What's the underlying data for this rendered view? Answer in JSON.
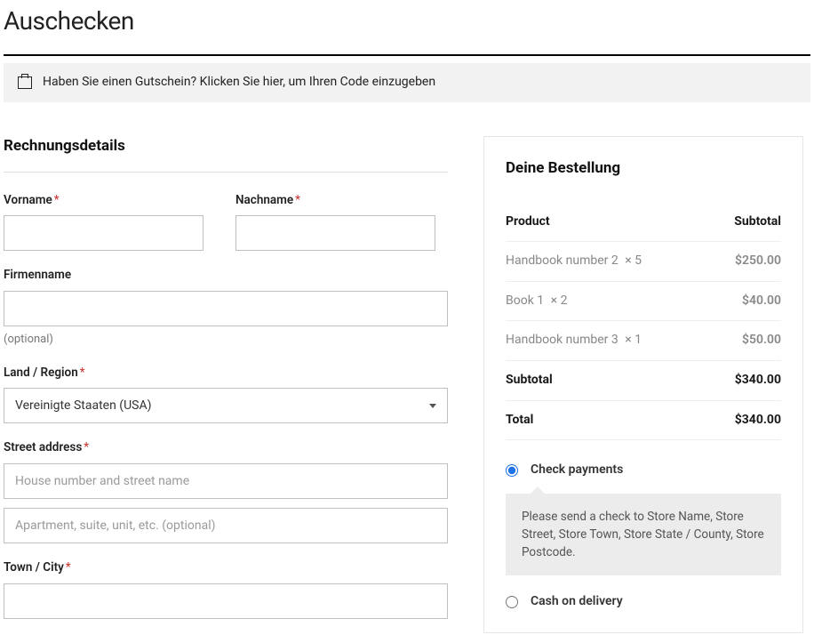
{
  "pageTitle": "Auschecken",
  "coupon": {
    "prompt": "Haben Sie einen Gutschein?",
    "link": "Klicken Sie hier, um Ihren Code einzugeben"
  },
  "billing": {
    "heading": "Rechnungsdetails",
    "firstNameLabel": "Vorname",
    "lastNameLabel": "Nachname",
    "companyLabel": "Firmenname",
    "companyOptional": "(optional)",
    "countryLabel": "Land / Region",
    "countryValue": "Vereinigte Staaten (USA)",
    "streetLabel": "Street address",
    "streetPlaceholder1": "House number and street name",
    "streetPlaceholder2": "Apartment, suite, unit, etc. (optional)",
    "townLabel": "Town / City"
  },
  "order": {
    "heading": "Deine Bestellung",
    "productHeader": "Product",
    "subtotalHeader": "Subtotal",
    "items": [
      {
        "name": "Handbook number 2",
        "qty": "× 5",
        "price": "$250.00"
      },
      {
        "name": "Book 1",
        "qty": "× 2",
        "price": "$40.00"
      },
      {
        "name": "Handbook number 3",
        "qty": "× 1",
        "price": "$50.00"
      }
    ],
    "subtotalLabel": "Subtotal",
    "subtotalValue": "$340.00",
    "totalLabel": "Total",
    "totalValue": "$340.00",
    "payments": {
      "checkLabel": "Check payments",
      "checkDesc": "Please send a check to Store Name, Store Street, Store Town, Store State / County, Store Postcode.",
      "codLabel": "Cash on delivery"
    }
  }
}
